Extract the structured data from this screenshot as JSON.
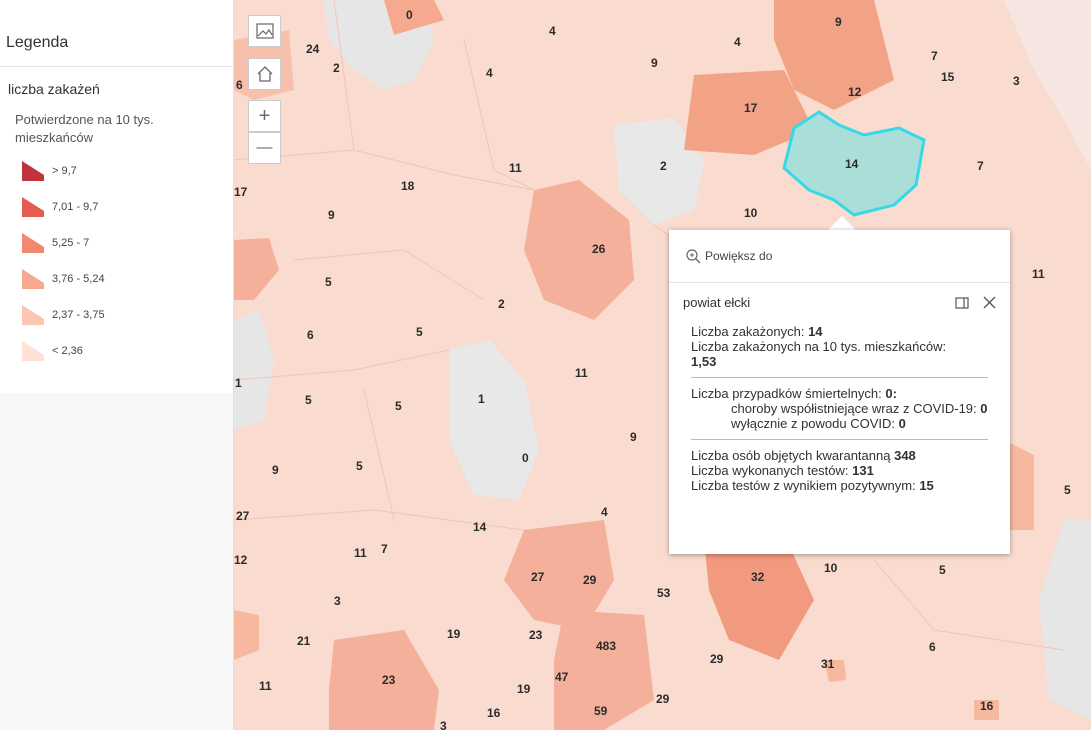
{
  "legend": {
    "title": "Legenda",
    "layer_title": "liczba zakażeń",
    "description": "Potwierdzone na 10 tys. mieszkańców",
    "classes": [
      {
        "label": "> 9,7",
        "color": "#c0323c"
      },
      {
        "label": "7,01 - 9,7",
        "color": "#e45b4f"
      },
      {
        "label": "5,25 - 7",
        "color": "#f2896e"
      },
      {
        "label": "3,76 - 5,24",
        "color": "#f7a98f"
      },
      {
        "label": "2,37 - 3,75",
        "color": "#fbc7b3"
      },
      {
        "label": "< 2,36",
        "color": "#fde1d5"
      }
    ]
  },
  "map": {
    "labels": [
      "0",
      "4",
      "9",
      "4",
      "9",
      "7",
      "15",
      "3",
      "24",
      "2",
      "4",
      "17",
      "12",
      "6",
      "2",
      "14",
      "7",
      "11",
      "18",
      "17",
      "9",
      "10",
      "26",
      "11",
      "5",
      "2",
      "6",
      "5",
      "1",
      "11",
      "5",
      "5",
      "1",
      "9",
      "0",
      "9",
      "5",
      "27",
      "14",
      "4",
      "5",
      "12",
      "11",
      "7",
      "27",
      "29",
      "32",
      "10",
      "5",
      "3",
      "53",
      "19",
      "23",
      "483",
      "21",
      "29",
      "31",
      "6",
      "23",
      "11",
      "47",
      "19",
      "59",
      "29",
      "16",
      "3",
      "16"
    ]
  },
  "popup": {
    "zoom_to": "Powiększ do",
    "title": "powiat ełcki",
    "cases_label": "Liczba zakażonych:",
    "cases_value": "14",
    "cases_per10k_label": "Liczba zakażonych na 10 tys. mieszkańców:",
    "cases_per10k_value": "1,53",
    "deaths_label": "Liczba przypadków śmiertelnych:",
    "deaths_value": "0:",
    "comorb_label": "choroby współistniejące wraz z COVID-19:",
    "comorb_value": "0",
    "covid_only_label": "wyłącznie z powodu COVID:",
    "covid_only_value": "0",
    "quarantine_label": "Liczba osób objętych kwarantanną",
    "quarantine_value": "348",
    "tests_label": "Liczba wykonanych testów:",
    "tests_value": "131",
    "positive_label": "Liczba testów z wynikiem pozytywnym:",
    "positive_value": "15"
  },
  "controls": {
    "zoom_in": "+",
    "zoom_out": "—"
  }
}
